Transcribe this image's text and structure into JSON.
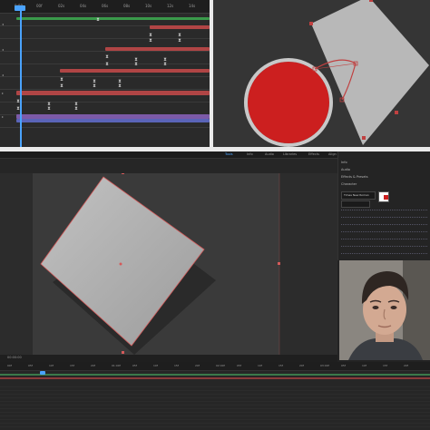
{
  "top_timeline": {
    "ruler_labels": [
      "0:00",
      "00f",
      "02s",
      "04s",
      "06s",
      "08s",
      "10s",
      "12s",
      "14s"
    ],
    "keyframe_glyph": "⧗",
    "playhead_color": "#4aa3ff",
    "track_colors": {
      "red": "#b04545",
      "green": "#3a9a4a",
      "blue": "#5a64b8",
      "violet": "#7c5aa8"
    }
  },
  "composition_preview": {
    "circle_fill": "#cc1f1f",
    "ring_color": "#e2e2e2",
    "square_fill": "#b4b4b4",
    "path_color": "#c04040"
  },
  "main_editor": {
    "header_tabs": [
      "Tools",
      "Info",
      "Audio",
      "Libraries",
      "Effects",
      "Align",
      "Search Help"
    ],
    "property_rows": [
      "Info",
      "Audio",
      "Effects & Presets",
      "Character"
    ],
    "font_field": "Times New Roman",
    "footer_text": "00:00:00",
    "canvas_bg": "#3a3a3a",
    "paste_bg": "#2c2c2c",
    "square_fill": "#ababab"
  },
  "bottom_timeline": {
    "ruler_labels": [
      "00f",
      "05f",
      "10f",
      "15f",
      "20f",
      "01:00f",
      "05f",
      "10f",
      "15f",
      "20f",
      "02:00f",
      "05f",
      "10f",
      "15f",
      "20f",
      "03:00f",
      "05f",
      "10f",
      "15f",
      "20f"
    ],
    "track_colors": {
      "green": "#3a7a4a",
      "red": "#8a3a3a"
    }
  }
}
